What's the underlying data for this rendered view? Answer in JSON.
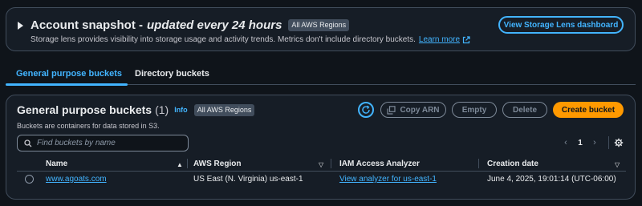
{
  "snapshot": {
    "title": "Account snapshot -",
    "title_suffix": "updated every 24 hours",
    "badge": "All AWS Regions",
    "description": "Storage lens provides visibility into storage usage and activity trends. Metrics don't include directory buckets.",
    "learn_more": "Learn more",
    "dashboard_button": "View Storage Lens dashboard"
  },
  "tabs": [
    {
      "label": "General purpose buckets",
      "active": true
    },
    {
      "label": "Directory buckets",
      "active": false
    }
  ],
  "buckets": {
    "title": "General purpose buckets",
    "count": "(1)",
    "info": "Info",
    "badge": "All AWS Regions",
    "description": "Buckets are containers for data stored in S3.",
    "actions": {
      "copy_arn": "Copy ARN",
      "empty": "Empty",
      "delete": "Delete",
      "create": "Create bucket"
    },
    "search_placeholder": "Find buckets by name",
    "pagination": {
      "page": "1",
      "prev": "‹",
      "next": "›"
    },
    "columns": [
      "Name",
      "AWS Region",
      "IAM Access Analyzer",
      "Creation date"
    ],
    "rows": [
      {
        "name": "www.agoats.com",
        "region": "US East (N. Virginia) us-east-1",
        "analyzer": "View analyzer for us-east-1",
        "created": "June 4, 2025, 19:01:14 (UTC-06:00)"
      }
    ]
  },
  "colors": {
    "accent": "#42b4ff",
    "primary_button": "#ff9900",
    "background": "#0f141a"
  }
}
